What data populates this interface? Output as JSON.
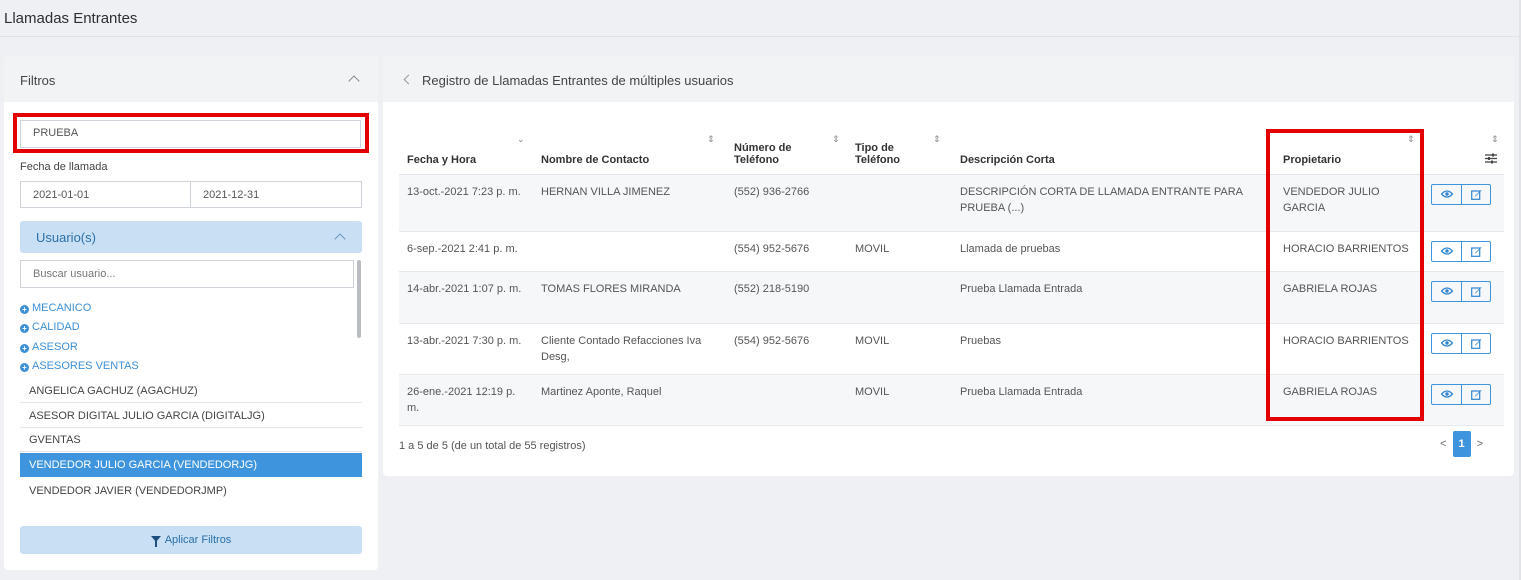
{
  "page": {
    "title": "Llamadas Entrantes"
  },
  "filters": {
    "title": "Filtros",
    "search_value": "PRUEBA",
    "date_label": "Fecha de llamada",
    "date_from": "2021-01-01",
    "date_to": "2021-12-31",
    "users_title": "Usuario(s)",
    "user_search_placeholder": "Buscar usuario...",
    "groups": [
      "MECANICO",
      "CALIDAD",
      "ASESOR",
      "ASESORES VENTAS"
    ],
    "users": [
      {
        "label": "ANGELICA GACHUZ (AGACHUZ)",
        "selected": false
      },
      {
        "label": "ASESOR DIGITAL JULIO GARCIA (DIGITALJG)",
        "selected": false
      },
      {
        "label": "GVENTAS",
        "selected": false
      },
      {
        "label": "VENDEDOR JULIO GARCIA (VENDEDORJG)",
        "selected": true
      },
      {
        "label": "VENDEDOR JAVIER (VENDEDORJMP)",
        "selected": false
      }
    ],
    "apply_label": "Aplicar Filtros"
  },
  "records": {
    "title": "Registro de Llamadas Entrantes de múltiples usuarios",
    "columns": [
      "Fecha y Hora",
      "Nombre de Contacto",
      "Número de Teléfono",
      "Tipo de Teléfono",
      "Descripción Corta",
      "Propietario"
    ],
    "rows": [
      {
        "fecha": "13-oct.-2021 7:23 p. m.",
        "contacto": "HERNAN VILLA JIMENEZ",
        "telefono": "(552) 936-2766",
        "tipo": "",
        "descripcion": "DESCRIPCIÓN CORTA DE LLAMADA ENTRANTE PARA PRUEBA (...)",
        "propietario": "VENDEDOR JULIO GARCIA"
      },
      {
        "fecha": "6-sep.-2021 2:41 p. m.",
        "contacto": "",
        "telefono": "(554) 952-5676",
        "tipo": "MOVIL",
        "descripcion": "Llamada de pruebas",
        "propietario": "HORACIO BARRIENTOS"
      },
      {
        "fecha": "14-abr.-2021 1:07 p. m.",
        "contacto": "TOMAS FLORES MIRANDA",
        "telefono": "(552) 218-5190",
        "tipo": "",
        "descripcion": "Prueba Llamada Entrada",
        "propietario": "GABRIELA ROJAS"
      },
      {
        "fecha": "13-abr.-2021 7:30 p. m.",
        "contacto": "Cliente Contado Refacciones Iva Desg,",
        "telefono": "(554) 952-5676",
        "tipo": "MOVIL",
        "descripcion": "Pruebas",
        "propietario": "HORACIO BARRIENTOS"
      },
      {
        "fecha": "26-ene.-2021 12:19 p. m.",
        "contacto": "Martinez Aponte, Raquel",
        "telefono": "",
        "tipo": "MOVIL",
        "descripcion": "Prueba Llamada Entrada",
        "propietario": "GABRIELA ROJAS"
      }
    ],
    "summary": "1 a 5 de 5 (de un total de 55 registros)",
    "pagination": {
      "prev": "<",
      "current": "1",
      "next": ">"
    }
  },
  "colors": {
    "accent": "#3f95dd",
    "highlight": "#e30000",
    "panel_header": "#f2f3f5",
    "light_blue": "#c9e0f4"
  },
  "icons": {
    "view": "eye-icon",
    "edit": "edit-icon",
    "columns": "sliders-icon",
    "sort": "sort-icon"
  }
}
